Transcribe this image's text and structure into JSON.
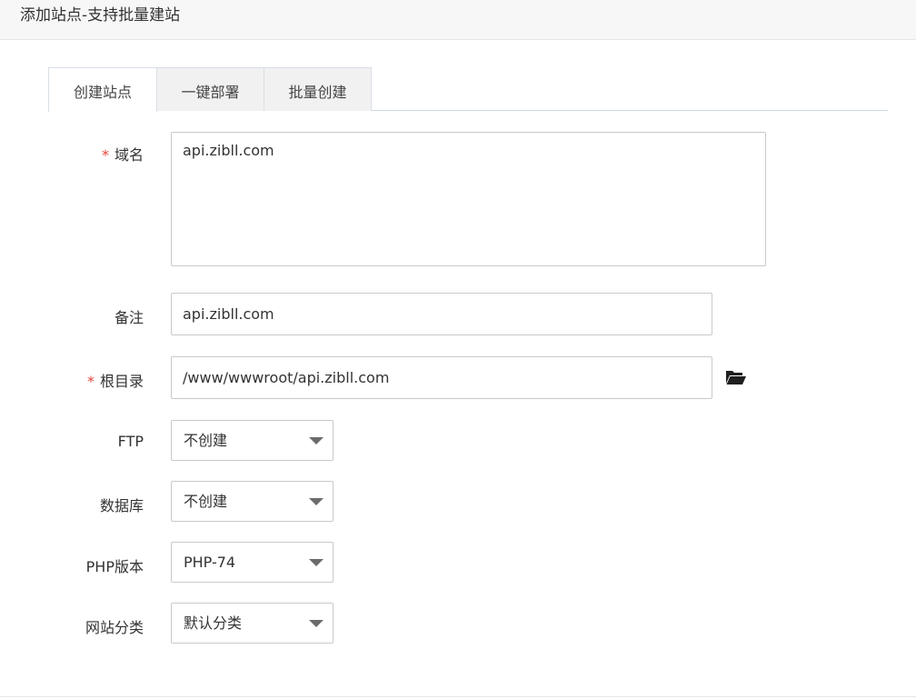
{
  "dialog": {
    "title": "添加站点-支持批量建站"
  },
  "tabs": [
    {
      "label": "创建站点",
      "active": true
    },
    {
      "label": "一键部署",
      "active": false
    },
    {
      "label": "批量创建",
      "active": false
    }
  ],
  "form": {
    "domain": {
      "required_mark": "*",
      "label": "域名",
      "value": "api.zibll.com"
    },
    "remark": {
      "label": "备注",
      "value": "api.zibll.com"
    },
    "root_dir": {
      "required_mark": "*",
      "label": "根目录",
      "value": "/www/wwwroot/api.zibll.com",
      "icon": "folder-open-icon"
    },
    "ftp": {
      "label": "FTP",
      "selected": "不创建"
    },
    "database": {
      "label": "数据库",
      "selected": "不创建"
    },
    "php_version": {
      "label": "PHP版本",
      "selected": "PHP-74"
    },
    "site_category": {
      "label": "网站分类",
      "selected": "默认分类"
    }
  },
  "colors": {
    "required": "#e8453c",
    "title_bar_bg": "#f7f7f7",
    "border": "#c9c9c9"
  }
}
